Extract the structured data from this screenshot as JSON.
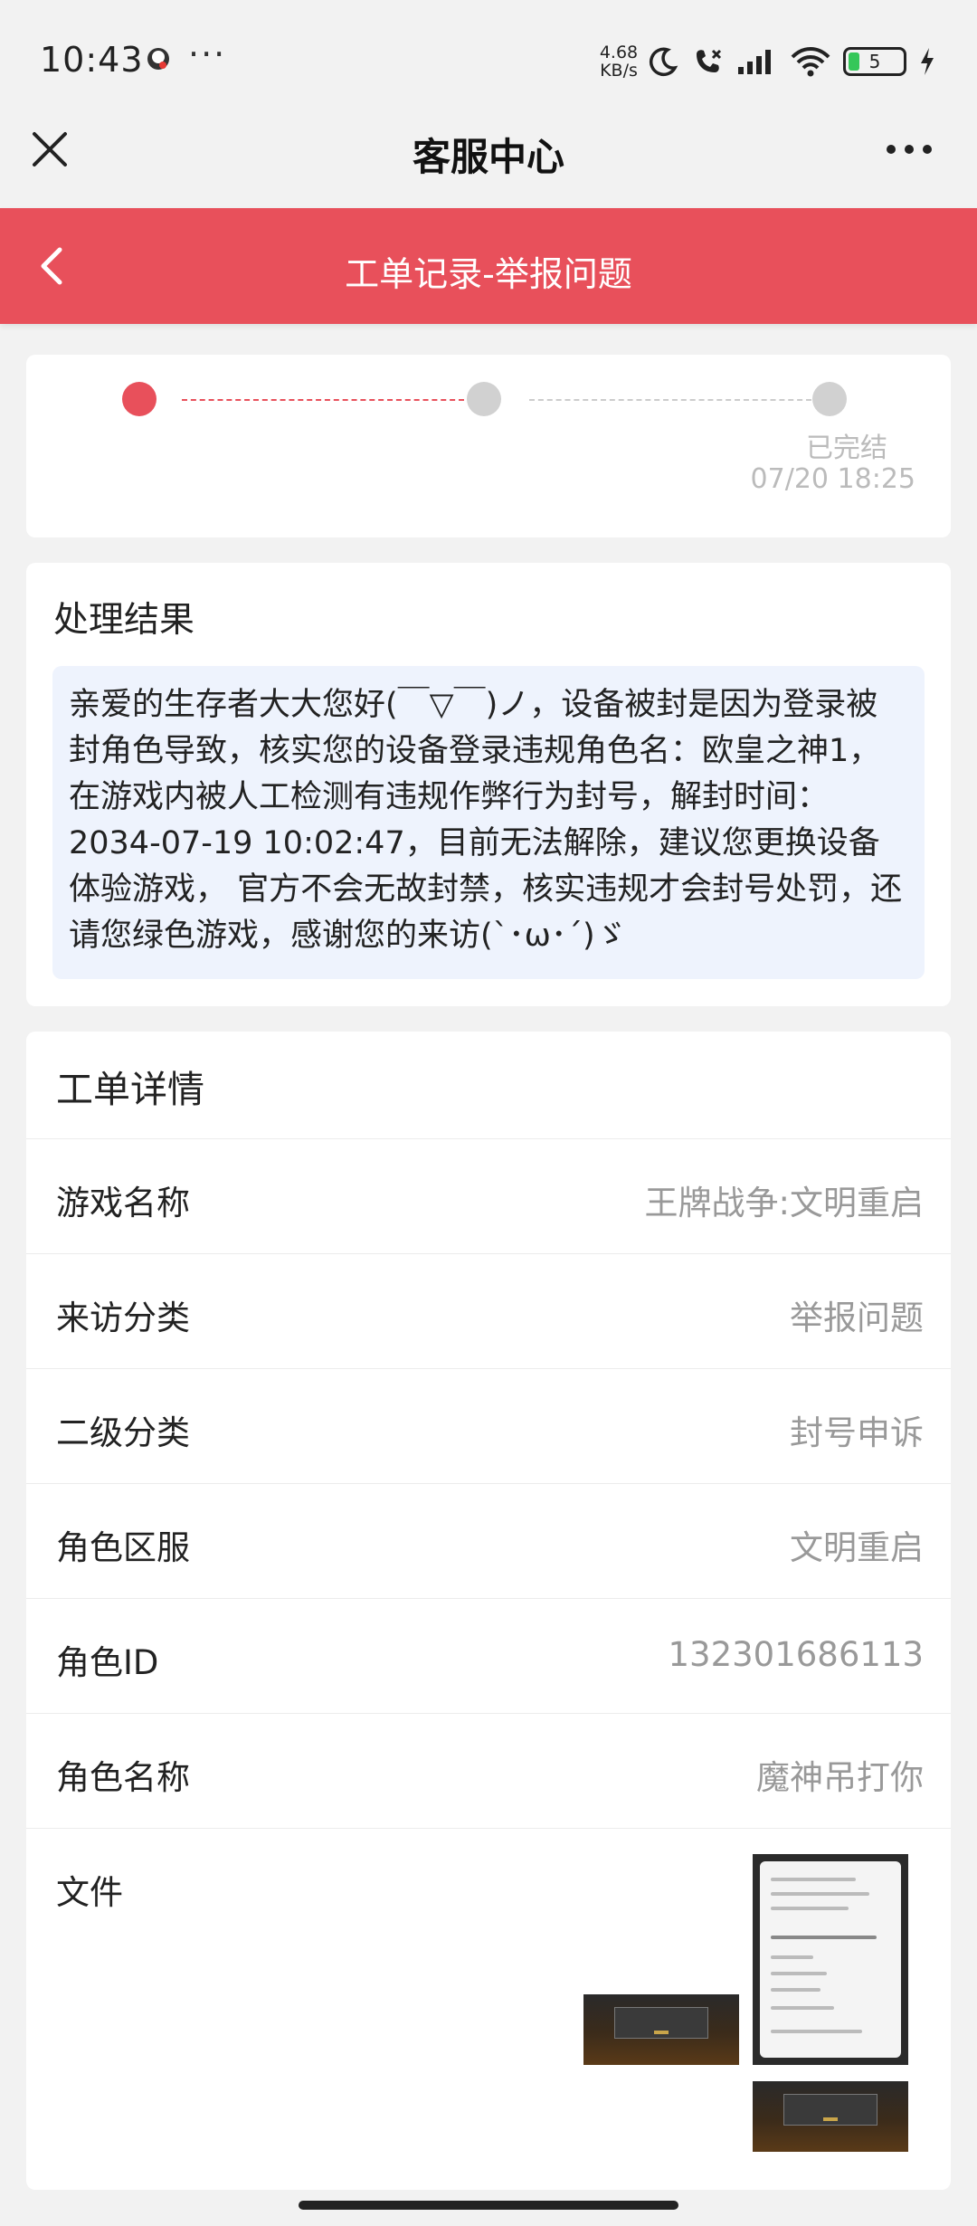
{
  "status_bar": {
    "time": "10:43",
    "more": "···",
    "net_speed": "4.68",
    "net_speed_unit": "KB/s",
    "battery": "5",
    "icons": [
      "moon-icon",
      "call-forward-icon",
      "signal-icon",
      "wifi-icon",
      "battery-icon",
      "charging-icon"
    ]
  },
  "nav": {
    "title": "客服中心",
    "close_icon": "close-icon",
    "more_icon": "more-dots-icon"
  },
  "header": {
    "title": "工单记录-举报问题",
    "back_icon": "back-arrow-icon",
    "color": "#e8505b"
  },
  "progress": {
    "final_label": "已完结",
    "final_time": "07/20 18:25",
    "active_color": "#e8505b",
    "inactive_color": "#d1d1d1"
  },
  "result": {
    "title": "处理结果",
    "message": "亲爱的生存者大大您好(￣▽￣)ノ，设备被封是因为登录被封角色导致，核实您的设备登录违规角色名：欧皇之神1，在游戏内被人工检测有违规作弊行为封号，解封时间：2034-07-19 10:02:47，目前无法解除，建议您更换设备体验游戏， 官方不会无故封禁，核实违规才会封号处罚，还请您绿色游戏，感谢您的来访(`･ω･´)ゞ"
  },
  "details": {
    "title": "工单详情",
    "rows": [
      {
        "label": "游戏名称",
        "value": "王牌战争:文明重启"
      },
      {
        "label": "来访分类",
        "value": "举报问题"
      },
      {
        "label": "二级分类",
        "value": "封号申诉"
      },
      {
        "label": "角色区服",
        "value": "文明重启"
      },
      {
        "label": "角色ID",
        "value": "132301686113"
      },
      {
        "label": "角色名称",
        "value": "魔神吊打你"
      }
    ],
    "files_label": "文件"
  }
}
